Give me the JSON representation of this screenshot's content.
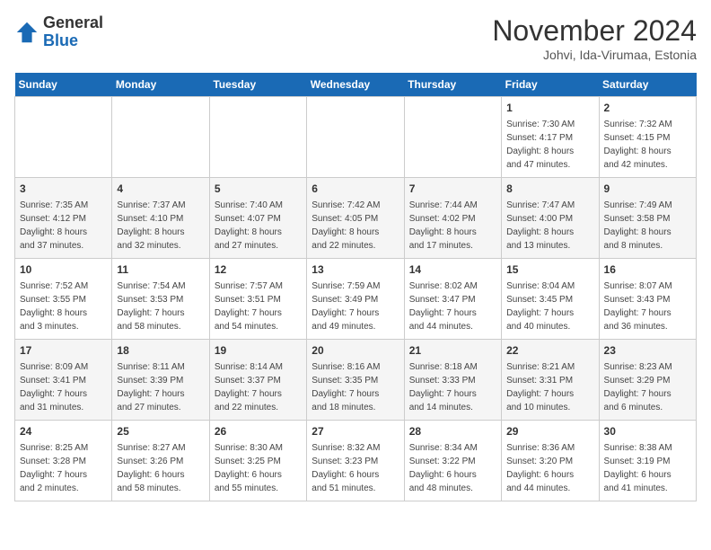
{
  "header": {
    "logo_general": "General",
    "logo_blue": "Blue",
    "month_year": "November 2024",
    "location": "Johvi, Ida-Virumaa, Estonia"
  },
  "calendar": {
    "days_of_week": [
      "Sunday",
      "Monday",
      "Tuesday",
      "Wednesday",
      "Thursday",
      "Friday",
      "Saturday"
    ],
    "weeks": [
      [
        {
          "day": "",
          "info": ""
        },
        {
          "day": "",
          "info": ""
        },
        {
          "day": "",
          "info": ""
        },
        {
          "day": "",
          "info": ""
        },
        {
          "day": "",
          "info": ""
        },
        {
          "day": "1",
          "info": "Sunrise: 7:30 AM\nSunset: 4:17 PM\nDaylight: 8 hours\nand 47 minutes."
        },
        {
          "day": "2",
          "info": "Sunrise: 7:32 AM\nSunset: 4:15 PM\nDaylight: 8 hours\nand 42 minutes."
        }
      ],
      [
        {
          "day": "3",
          "info": "Sunrise: 7:35 AM\nSunset: 4:12 PM\nDaylight: 8 hours\nand 37 minutes."
        },
        {
          "day": "4",
          "info": "Sunrise: 7:37 AM\nSunset: 4:10 PM\nDaylight: 8 hours\nand 32 minutes."
        },
        {
          "day": "5",
          "info": "Sunrise: 7:40 AM\nSunset: 4:07 PM\nDaylight: 8 hours\nand 27 minutes."
        },
        {
          "day": "6",
          "info": "Sunrise: 7:42 AM\nSunset: 4:05 PM\nDaylight: 8 hours\nand 22 minutes."
        },
        {
          "day": "7",
          "info": "Sunrise: 7:44 AM\nSunset: 4:02 PM\nDaylight: 8 hours\nand 17 minutes."
        },
        {
          "day": "8",
          "info": "Sunrise: 7:47 AM\nSunset: 4:00 PM\nDaylight: 8 hours\nand 13 minutes."
        },
        {
          "day": "9",
          "info": "Sunrise: 7:49 AM\nSunset: 3:58 PM\nDaylight: 8 hours\nand 8 minutes."
        }
      ],
      [
        {
          "day": "10",
          "info": "Sunrise: 7:52 AM\nSunset: 3:55 PM\nDaylight: 8 hours\nand 3 minutes."
        },
        {
          "day": "11",
          "info": "Sunrise: 7:54 AM\nSunset: 3:53 PM\nDaylight: 7 hours\nand 58 minutes."
        },
        {
          "day": "12",
          "info": "Sunrise: 7:57 AM\nSunset: 3:51 PM\nDaylight: 7 hours\nand 54 minutes."
        },
        {
          "day": "13",
          "info": "Sunrise: 7:59 AM\nSunset: 3:49 PM\nDaylight: 7 hours\nand 49 minutes."
        },
        {
          "day": "14",
          "info": "Sunrise: 8:02 AM\nSunset: 3:47 PM\nDaylight: 7 hours\nand 44 minutes."
        },
        {
          "day": "15",
          "info": "Sunrise: 8:04 AM\nSunset: 3:45 PM\nDaylight: 7 hours\nand 40 minutes."
        },
        {
          "day": "16",
          "info": "Sunrise: 8:07 AM\nSunset: 3:43 PM\nDaylight: 7 hours\nand 36 minutes."
        }
      ],
      [
        {
          "day": "17",
          "info": "Sunrise: 8:09 AM\nSunset: 3:41 PM\nDaylight: 7 hours\nand 31 minutes."
        },
        {
          "day": "18",
          "info": "Sunrise: 8:11 AM\nSunset: 3:39 PM\nDaylight: 7 hours\nand 27 minutes."
        },
        {
          "day": "19",
          "info": "Sunrise: 8:14 AM\nSunset: 3:37 PM\nDaylight: 7 hours\nand 22 minutes."
        },
        {
          "day": "20",
          "info": "Sunrise: 8:16 AM\nSunset: 3:35 PM\nDaylight: 7 hours\nand 18 minutes."
        },
        {
          "day": "21",
          "info": "Sunrise: 8:18 AM\nSunset: 3:33 PM\nDaylight: 7 hours\nand 14 minutes."
        },
        {
          "day": "22",
          "info": "Sunrise: 8:21 AM\nSunset: 3:31 PM\nDaylight: 7 hours\nand 10 minutes."
        },
        {
          "day": "23",
          "info": "Sunrise: 8:23 AM\nSunset: 3:29 PM\nDaylight: 7 hours\nand 6 minutes."
        }
      ],
      [
        {
          "day": "24",
          "info": "Sunrise: 8:25 AM\nSunset: 3:28 PM\nDaylight: 7 hours\nand 2 minutes."
        },
        {
          "day": "25",
          "info": "Sunrise: 8:27 AM\nSunset: 3:26 PM\nDaylight: 6 hours\nand 58 minutes."
        },
        {
          "day": "26",
          "info": "Sunrise: 8:30 AM\nSunset: 3:25 PM\nDaylight: 6 hours\nand 55 minutes."
        },
        {
          "day": "27",
          "info": "Sunrise: 8:32 AM\nSunset: 3:23 PM\nDaylight: 6 hours\nand 51 minutes."
        },
        {
          "day": "28",
          "info": "Sunrise: 8:34 AM\nSunset: 3:22 PM\nDaylight: 6 hours\nand 48 minutes."
        },
        {
          "day": "29",
          "info": "Sunrise: 8:36 AM\nSunset: 3:20 PM\nDaylight: 6 hours\nand 44 minutes."
        },
        {
          "day": "30",
          "info": "Sunrise: 8:38 AM\nSunset: 3:19 PM\nDaylight: 6 hours\nand 41 minutes."
        }
      ]
    ]
  }
}
